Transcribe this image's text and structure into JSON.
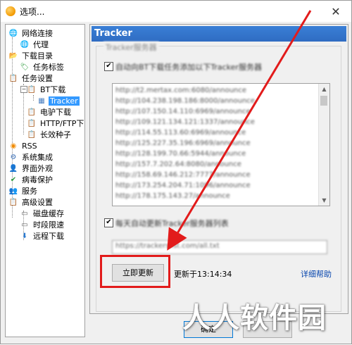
{
  "window": {
    "title": "选项..."
  },
  "tree": {
    "items": [
      {
        "label": "网络连接",
        "icon": "globe-icon",
        "glyph": "🌐"
      },
      {
        "label": "代理",
        "icon": "proxy-icon",
        "glyph": "🌐"
      },
      {
        "label": "下载目录",
        "icon": "folder-icon",
        "glyph": "📂"
      },
      {
        "label": "任务标签",
        "icon": "tag-icon",
        "glyph": "🏷"
      },
      {
        "label": "任务设置",
        "icon": "task-settings-icon",
        "glyph": "📋"
      },
      {
        "label": "BT下载",
        "icon": "bt-icon",
        "glyph": "📋"
      },
      {
        "label": "Tracker",
        "icon": "tracker-icon",
        "glyph": "▦"
      },
      {
        "label": "电驴下载",
        "icon": "emule-icon",
        "glyph": "📋"
      },
      {
        "label": "HTTP/FTP下载",
        "icon": "http-icon",
        "glyph": "📋"
      },
      {
        "label": "长效种子",
        "icon": "seed-icon",
        "glyph": "📋"
      },
      {
        "label": "RSS",
        "icon": "rss-icon",
        "glyph": "◉"
      },
      {
        "label": "系统集成",
        "icon": "integration-icon",
        "glyph": "⚙"
      },
      {
        "label": "界面外观",
        "icon": "appearance-icon",
        "glyph": "👤"
      },
      {
        "label": "病毒保护",
        "icon": "shield-icon",
        "glyph": "✔"
      },
      {
        "label": "服务",
        "icon": "service-icon",
        "glyph": "👥"
      },
      {
        "label": "高级设置",
        "icon": "advanced-icon",
        "glyph": "📋"
      },
      {
        "label": "磁盘缓存",
        "icon": "disk-cache-icon",
        "glyph": "▭"
      },
      {
        "label": "时段限速",
        "icon": "speed-limit-icon",
        "glyph": "▭"
      },
      {
        "label": "远程下载",
        "icon": "remote-download-icon",
        "glyph": "⬇"
      }
    ]
  },
  "panel": {
    "header": "Tracker",
    "group_title": "Tracker服务器",
    "auto_add_label": "自动向BT下载任务添加以下Tracker服务器",
    "tracker_list": [
      "http://t2.mertax.com:6080/announce",
      "http://104.238.198.186:8000/announce",
      "http://107.150.14.110:6969/announce",
      "http://109.121.134.121:1337/announce",
      "http://114.55.113.60:6969/announce",
      "http://125.227.35.196:6969/announce",
      "http://128.199.70.66:5944/announce",
      "http://157.7.202.64:8080/announce",
      "http://158.69.146.212:7777/announce",
      "http://173.254.204.71:1096/announce",
      "http://178.175.143.27/announce"
    ],
    "auto_update_label": "每天自动更新Tracker服务器列表",
    "update_url": "https://trackerslist.com/all.txt",
    "update_button": "立即更新",
    "updated_text": "更新于13:14:34",
    "help_link": "详细帮助"
  },
  "footer": {
    "ok_button": "确定"
  },
  "watermark": "人人软件园",
  "colors": {
    "highlight": "#e21b1b",
    "header": "#2f6cc2",
    "selection": "#3399ff"
  }
}
